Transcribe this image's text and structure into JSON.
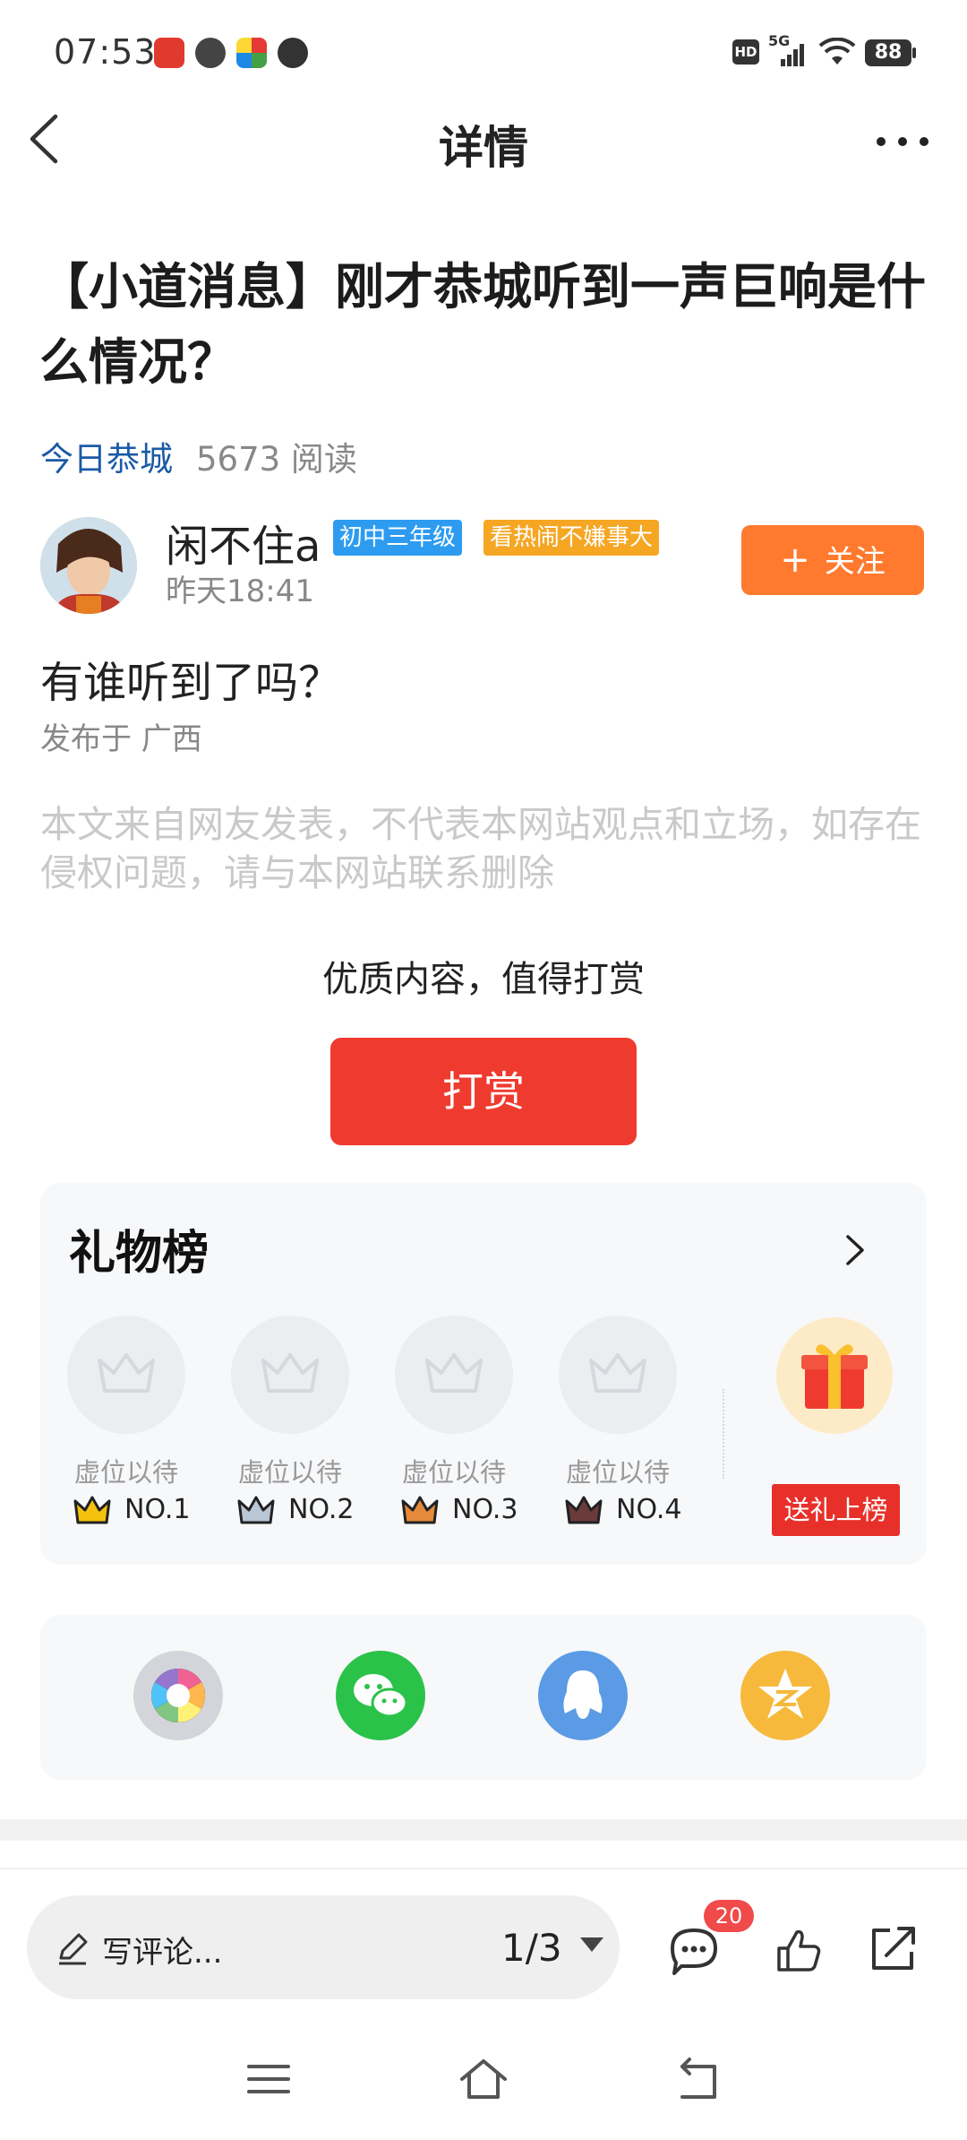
{
  "status_bar": {
    "time": "07:53",
    "network": "5G",
    "hd_label": "HD",
    "battery": "88"
  },
  "nav": {
    "title": "详情"
  },
  "article": {
    "title": "【小道消息】刚才恭城听到一声巨响是什么情况？",
    "source": "今日恭城",
    "read_count": "5673 阅读",
    "author": {
      "name": "闲不住a",
      "badges": [
        "初中三年级",
        "看热闹不嫌事大"
      ],
      "time": "昨天18:41",
      "follow_label": "关注",
      "follow_plus": "+"
    },
    "content": "有谁听到了吗？",
    "location": "发布于 广西",
    "disclaimer": "本文来自网友发表，不代表本网站观点和立场，如存在侵权问题，请与本网站联系删除",
    "reward_prompt": "优质内容，值得打赏",
    "reward_button": "打赏"
  },
  "gift_board": {
    "title": "礼物榜",
    "slots": [
      {
        "label": "虚位以待",
        "rank": "NO.1",
        "crown_color": "#f4c20d"
      },
      {
        "label": "虚位以待",
        "rank": "NO.2",
        "crown_color": "#b9c6d6"
      },
      {
        "label": "虚位以待",
        "rank": "NO.3",
        "crown_color": "#e58a3a"
      },
      {
        "label": "虚位以待",
        "rank": "NO.4",
        "crown_color": "#6b3b3b"
      }
    ],
    "send_gift_label": "送礼上榜"
  },
  "share": {
    "icons": [
      "moments-icon",
      "wechat-icon",
      "qq-icon",
      "qzone-icon"
    ]
  },
  "bottom_bar": {
    "comment_placeholder": "写评论...",
    "page_indicator": "1/3",
    "comment_count": "20"
  },
  "colors": {
    "accent_orange": "#ff7a2e",
    "reward_red": "#ef3b2f",
    "link_blue": "#1a5aa6"
  }
}
